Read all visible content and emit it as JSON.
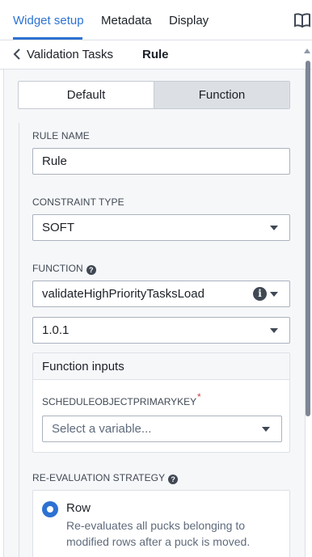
{
  "tabs": [
    {
      "label": "Widget setup",
      "active": true
    },
    {
      "label": "Metadata",
      "active": false
    },
    {
      "label": "Display",
      "active": false
    }
  ],
  "breadcrumb": {
    "parent": "Validation Tasks",
    "current": "Rule"
  },
  "mode_toggle": {
    "options": [
      "Default",
      "Function"
    ],
    "selected": "Function"
  },
  "rule_name": {
    "label": "RULE NAME",
    "value": "Rule"
  },
  "constraint_type": {
    "label": "CONSTRAINT TYPE",
    "value": "SOFT"
  },
  "function": {
    "label": "FUNCTION",
    "name": "validateHighPriorityTasksLoad",
    "version": "1.0.1"
  },
  "function_inputs": {
    "title": "Function inputs",
    "param_label": "SCHEDULEOBJECTPRIMARYKEY",
    "required_mark": "*",
    "placeholder": "Select a variable..."
  },
  "reevaluation": {
    "label": "RE-EVALUATION STRATEGY",
    "option_title": "Row",
    "option_desc": "Re-evaluates all pucks belonging to modified rows after a puck is moved."
  },
  "colors": {
    "accent": "#2d72d2",
    "required": "#cd4246"
  },
  "icons": {
    "docs": "book-icon",
    "back": "chevron-left-icon",
    "help": "help-icon",
    "info": "info-icon",
    "dropdown": "caret-down-icon"
  }
}
